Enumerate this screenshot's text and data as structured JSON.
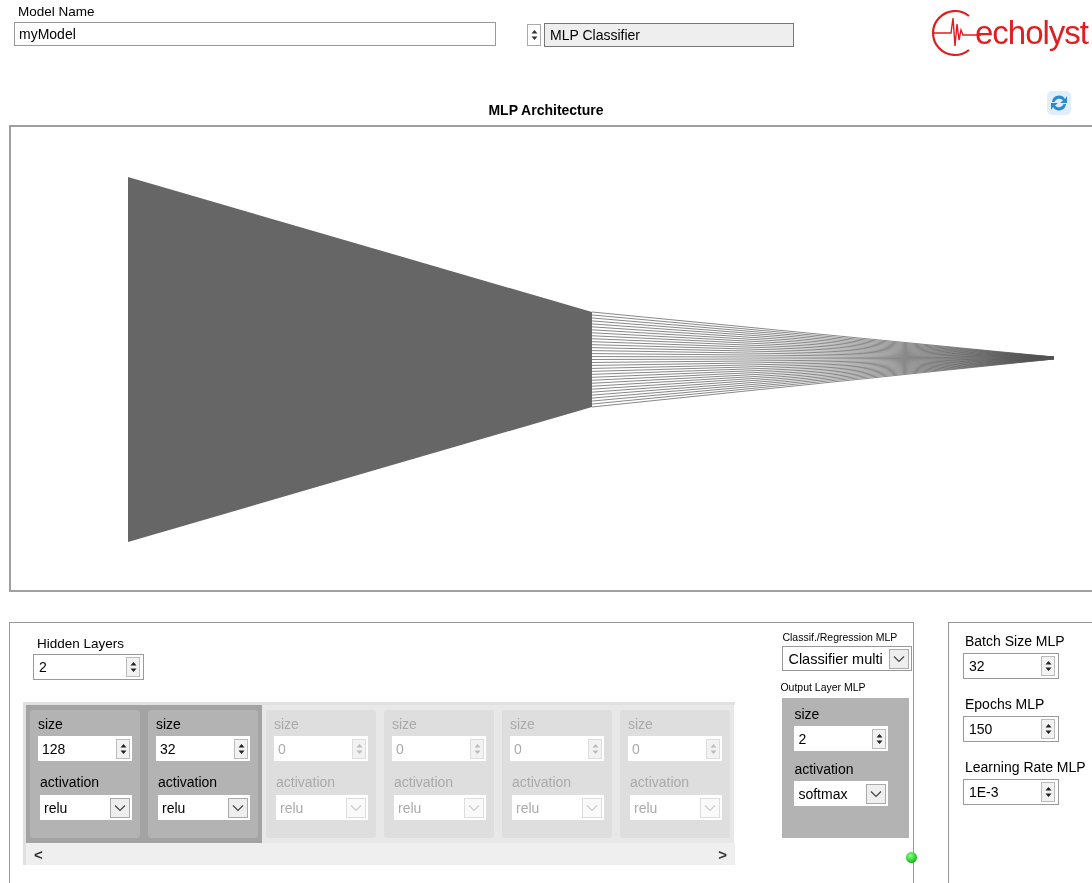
{
  "model_name": {
    "label": "Model Name",
    "value": "myModel"
  },
  "model_type": {
    "value": "MLP Classifier"
  },
  "logo": {
    "text": "echolyst"
  },
  "architecture": {
    "title": "MLP Architecture"
  },
  "hidden_layers": {
    "label": "Hidden Layers",
    "value": "2"
  },
  "layers": [
    {
      "size_label": "size",
      "size": "128",
      "activation_label": "activation",
      "activation": "relu",
      "disabled": false
    },
    {
      "size_label": "size",
      "size": "32",
      "activation_label": "activation",
      "activation": "relu",
      "disabled": false
    },
    {
      "size_label": "size",
      "size": "0",
      "activation_label": "activation",
      "activation": "relu",
      "disabled": true
    },
    {
      "size_label": "size",
      "size": "0",
      "activation_label": "activation",
      "activation": "relu",
      "disabled": true
    },
    {
      "size_label": "size",
      "size": "0",
      "activation_label": "activation",
      "activation": "relu",
      "disabled": true
    },
    {
      "size_label": "size",
      "size": "0",
      "activation_label": "activation",
      "activation": "relu",
      "disabled": true
    }
  ],
  "scroll_left": "<",
  "scroll_right": ">",
  "task": {
    "label": "Classif./Regression MLP",
    "value": "Classifier multi"
  },
  "output_layer": {
    "label": "Output Layer MLP",
    "size_label": "size",
    "size": "2",
    "activation_label": "activation",
    "activation": "softmax"
  },
  "status_light": {
    "on": true
  },
  "training": [
    {
      "label": "Batch Size MLP",
      "value": "32"
    },
    {
      "label": "Epochs MLP",
      "value": "150"
    },
    {
      "label": "Learning Rate MLP",
      "value": "1E-3"
    }
  ]
}
